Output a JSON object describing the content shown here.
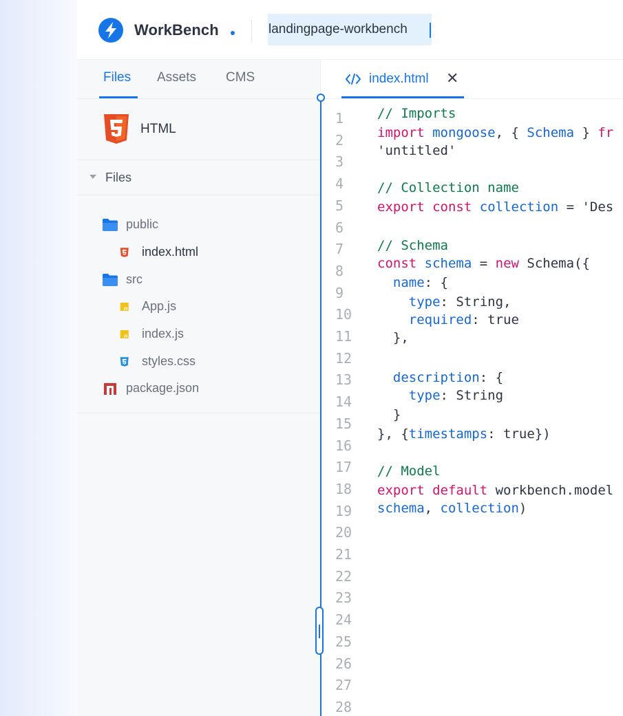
{
  "header": {
    "brand": "WorkBench",
    "project_name": "landingpage-workbench"
  },
  "sidebar": {
    "tabs": [
      {
        "label": "Files",
        "active": true
      },
      {
        "label": "Assets",
        "active": false
      },
      {
        "label": "CMS",
        "active": false
      }
    ],
    "template": {
      "label": "HTML",
      "icon": "html5-icon"
    },
    "section": {
      "label": "Files",
      "expanded": true
    },
    "tree": [
      {
        "label": "public",
        "icon": "folder-icon",
        "depth": 0
      },
      {
        "label": "index.html",
        "icon": "html-file-icon",
        "depth": 1,
        "selected": true
      },
      {
        "label": "src",
        "icon": "folder-icon",
        "depth": 0
      },
      {
        "label": "App.js",
        "icon": "js-file-icon",
        "depth": 1
      },
      {
        "label": "index.js",
        "icon": "js-file-icon",
        "depth": 1
      },
      {
        "label": "styles.css",
        "icon": "css-file-icon",
        "depth": 1
      },
      {
        "label": "package.json",
        "icon": "npm-icon",
        "depth": 0
      }
    ]
  },
  "editor": {
    "tab": {
      "label": "index.html",
      "icon": "code-icon",
      "close": "✕"
    },
    "line_numbers": [
      "1",
      "2",
      "3",
      "4",
      "5",
      "6",
      "7",
      "8",
      "9",
      "10",
      "11",
      "12",
      "13",
      "14",
      "15",
      "16",
      "17",
      "18",
      "19",
      "20",
      "21",
      "22",
      "23",
      "24",
      "25",
      "26",
      "27",
      "28"
    ],
    "code": [
      [
        [
          "c",
          "// Imports"
        ]
      ],
      [
        [
          "k",
          "import"
        ],
        [
          "t",
          " "
        ],
        [
          "i",
          "mongoose"
        ],
        [
          "t",
          ", { "
        ],
        [
          "i",
          "Schema"
        ],
        [
          "t",
          " } "
        ],
        [
          "k",
          "fr"
        ]
      ],
      [
        [
          "t",
          "'untitled'"
        ]
      ],
      [],
      [
        [
          "c",
          "// Collection name"
        ]
      ],
      [
        [
          "k",
          "export"
        ],
        [
          "t",
          " "
        ],
        [
          "k",
          "const"
        ],
        [
          "t",
          " "
        ],
        [
          "i",
          "collection"
        ],
        [
          "t",
          " = 'Des"
        ]
      ],
      [],
      [
        [
          "c",
          "// Schema"
        ]
      ],
      [
        [
          "k",
          "const"
        ],
        [
          "t",
          " "
        ],
        [
          "i",
          "schema"
        ],
        [
          "t",
          " = "
        ],
        [
          "k",
          "new"
        ],
        [
          "t",
          " Schema({"
        ]
      ],
      [
        [
          "t",
          "  "
        ],
        [
          "i",
          "name"
        ],
        [
          "t",
          ": {"
        ]
      ],
      [
        [
          "t",
          "    "
        ],
        [
          "i",
          "type"
        ],
        [
          "t",
          ": String,"
        ]
      ],
      [
        [
          "t",
          "    "
        ],
        [
          "i",
          "required"
        ],
        [
          "t",
          ": true"
        ]
      ],
      [
        [
          "t",
          "  },"
        ]
      ],
      [],
      [
        [
          "t",
          "  "
        ],
        [
          "i",
          "description"
        ],
        [
          "t",
          ": {"
        ]
      ],
      [
        [
          "t",
          "    "
        ],
        [
          "i",
          "type"
        ],
        [
          "t",
          ": String"
        ]
      ],
      [
        [
          "t",
          "  }"
        ]
      ],
      [
        [
          "t",
          "}, {"
        ],
        [
          "i",
          "timestamps"
        ],
        [
          "t",
          ": true})"
        ]
      ],
      [],
      [
        [
          "c",
          "// Model"
        ]
      ],
      [
        [
          "k",
          "export"
        ],
        [
          "t",
          " "
        ],
        [
          "k",
          "default"
        ],
        [
          "t",
          " workbench.model"
        ]
      ],
      [
        [
          "i",
          "schema"
        ],
        [
          "t",
          ", "
        ],
        [
          "i",
          "collection"
        ],
        [
          "t",
          ")"
        ]
      ]
    ]
  },
  "colors": {
    "accent": "#1676e8",
    "comment": "#0c7d4a",
    "keyword": "#d4136b",
    "identifier": "#1468d4",
    "html_orange": "#e44d26",
    "js_yellow": "#f2c21a",
    "css_blue": "#1f8fe0",
    "npm_red": "#cb3837"
  }
}
